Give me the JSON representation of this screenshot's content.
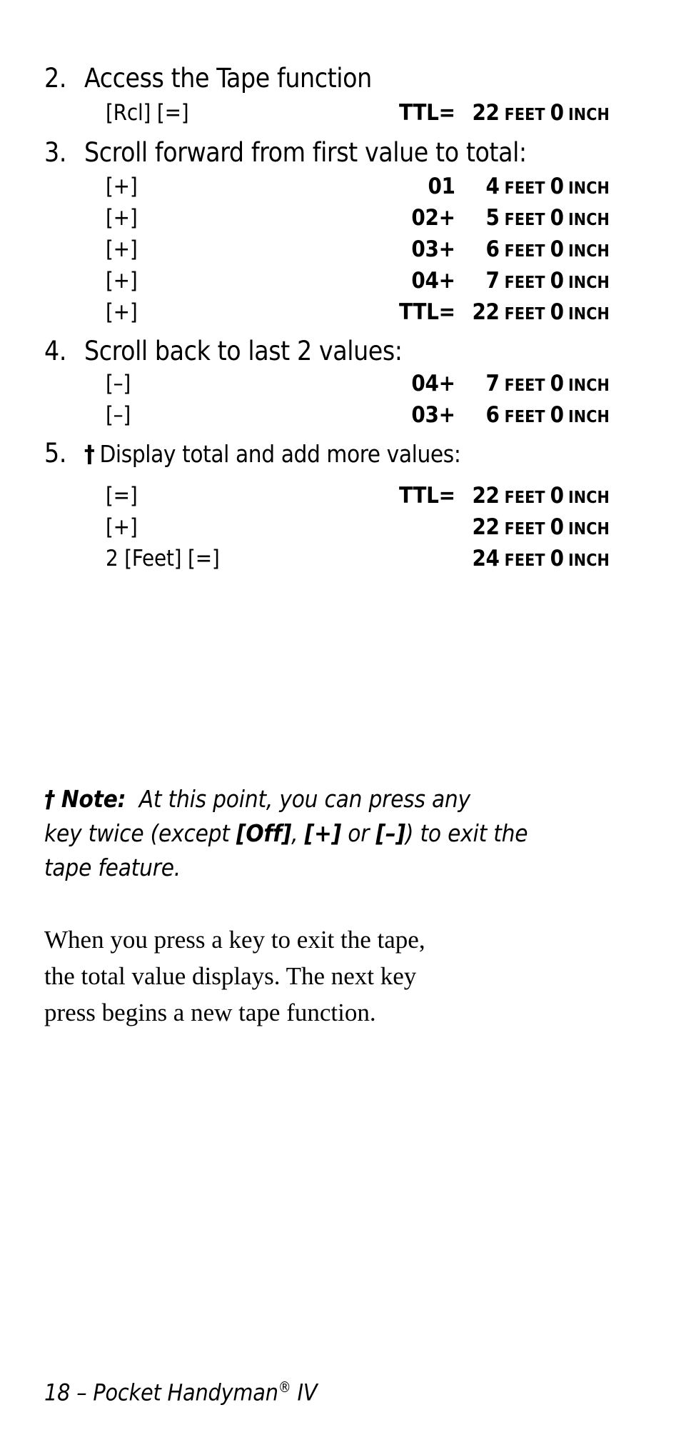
{
  "page": {
    "footer_page_number": "18",
    "footer_dash": "–",
    "footer_title": "Pocket Handyman",
    "footer_reg_mark": "®",
    "footer_edition": "IV",
    "footer_full": "18 – Pocket Handyman® IV"
  },
  "steps": [
    {
      "number": "2.",
      "text": "Access the Tape function",
      "dagger": "",
      "rows": [
        {
          "key": "[Rcl] [=]",
          "counter": "TTL=",
          "value": "22",
          "unit1": "FEET",
          "value2": "0",
          "unit2": "INCH"
        }
      ]
    },
    {
      "number": "3.",
      "text": "Scroll forward from first value to total:",
      "dagger": "",
      "rows": [
        {
          "key": "[+]",
          "counter": "01",
          "value": "4",
          "unit1": "FEET",
          "value2": "0",
          "unit2": "INCH"
        },
        {
          "key": "[+]",
          "counter": "02+",
          "value": "5",
          "unit1": "FEET",
          "value2": "0",
          "unit2": "INCH"
        },
        {
          "key": "[+]",
          "counter": "03+",
          "value": "6",
          "unit1": "FEET",
          "value2": "0",
          "unit2": "INCH"
        },
        {
          "key": "[+]",
          "counter": "04+",
          "value": "7",
          "unit1": "FEET",
          "value2": "0",
          "unit2": "INCH"
        },
        {
          "key": "[+]",
          "counter": "TTL=",
          "value": "22",
          "unit1": "FEET",
          "value2": "0",
          "unit2": "INCH"
        }
      ]
    },
    {
      "number": "4.",
      "text": "Scroll back to last 2 values:",
      "dagger": "",
      "rows": [
        {
          "key": "[–]",
          "counter": "04+",
          "value": "7",
          "unit1": "FEET",
          "value2": "0",
          "unit2": "INCH"
        },
        {
          "key": "[–]",
          "counter": "03+",
          "value": "6",
          "unit1": "FEET",
          "value2": "0",
          "unit2": "INCH"
        }
      ]
    },
    {
      "number": "5.",
      "text": "Display total and add more values:",
      "dagger": "†",
      "rows": [
        {
          "key": "[=]",
          "counter": "TTL=",
          "value": "22",
          "unit1": "FEET",
          "value2": "0",
          "unit2": "INCH"
        },
        {
          "key": "[+]",
          "counter": "",
          "value": "22",
          "unit1": "FEET",
          "value2": "0",
          "unit2": "INCH"
        },
        {
          "key": "2 [Feet] [=]",
          "counter": "",
          "value": "24",
          "unit1": "FEET",
          "value2": "0",
          "unit2": "INCH"
        }
      ]
    }
  ],
  "note": {
    "dagger": "†",
    "label": "Note:",
    "line1_a": "At this point, you can press any",
    "line2_a": "key twice (except ",
    "line2_b": "[Off]",
    "line2_c": ", ",
    "line2_d": "[+]",
    "line2_e": " or ",
    "line2_f": "[–]",
    "line2_g": ") to exit the",
    "line3": "tape feature.",
    "full_text": "† Note:  At this point, you can press any key twice (except [Off], [+] or [–]) to exit the tape feature."
  },
  "paragraph": {
    "line1": "When you press a key to exit the tape,",
    "line2": "the total value displays. The next key",
    "line3": "press begins a new tape function.",
    "full_text": "When you press a key to exit the tape, the total value displays. The next key press begins a new tape function."
  }
}
